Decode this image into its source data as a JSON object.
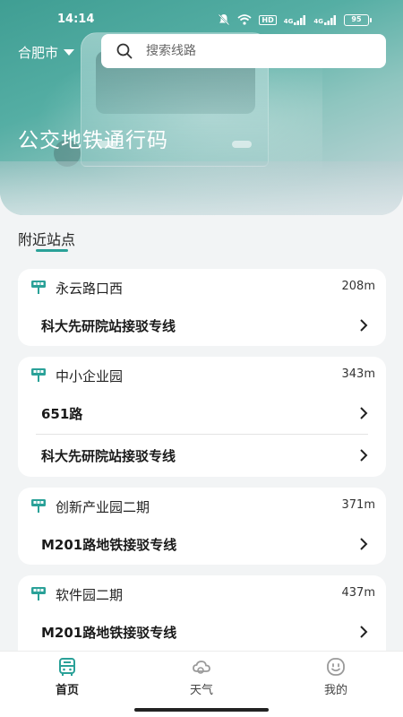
{
  "status_bar": {
    "time": "14:14",
    "network_badge": "HD",
    "signal_1": "4G",
    "signal_2": "4G",
    "battery": "95"
  },
  "header": {
    "city": "合肥市",
    "search_placeholder": "搜索线路",
    "title": "公交地铁通行码"
  },
  "nearby": {
    "section_title": "附近站点",
    "stops": [
      {
        "name": "永云路口西",
        "distance": "208m",
        "routes": [
          "科大先研院站接驳专线"
        ]
      },
      {
        "name": "中小企业园",
        "distance": "343m",
        "routes": [
          "651路",
          "科大先研院站接驳专线"
        ]
      },
      {
        "name": "创新产业园二期",
        "distance": "371m",
        "routes": [
          "M201路地铁接驳专线"
        ]
      },
      {
        "name": "软件园二期",
        "distance": "437m",
        "routes": [
          "M201路地铁接驳专线"
        ]
      }
    ]
  },
  "tabbar": {
    "home": "首页",
    "weather": "天气",
    "mine": "我的"
  },
  "colors": {
    "accent": "#2aa198",
    "hero_gradient_start": "#3f9e93",
    "background": "#f2f4f5"
  },
  "icons": {
    "search": "search-icon",
    "stop": "bus-stop-icon",
    "chevron": "chevron-right-icon",
    "home_tab": "bus-icon",
    "weather_tab": "cloud-sun-icon",
    "mine_tab": "smile-face-icon"
  }
}
